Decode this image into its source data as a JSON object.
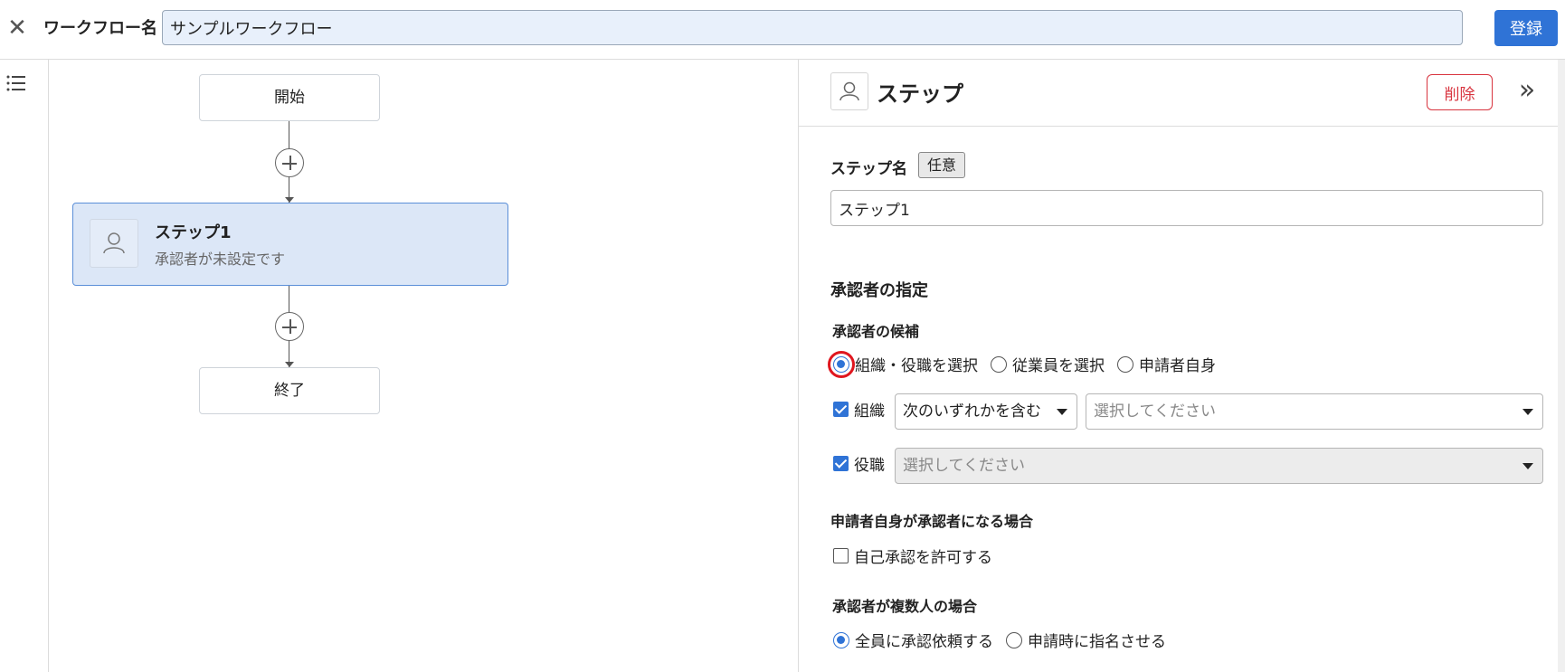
{
  "header": {
    "workflow_name_label": "ワークフロー名",
    "workflow_name_value": "サンプルワークフロー",
    "register_label": "登録"
  },
  "canvas": {
    "start_label": "開始",
    "end_label": "終了",
    "step": {
      "title": "ステップ1",
      "subtitle": "承認者が未設定です"
    }
  },
  "panel": {
    "title": "ステップ",
    "delete_label": "削除",
    "step_name_label": "ステップ名",
    "optional_badge": "任意",
    "step_name_value": "ステップ1",
    "approver_spec_heading": "承認者の指定",
    "candidates_label": "承認者の候補",
    "candidate_options": [
      {
        "label": "組織・役職を選択",
        "selected": true
      },
      {
        "label": "従業員を選択",
        "selected": false
      },
      {
        "label": "申請者自身",
        "selected": false
      }
    ],
    "org": {
      "label": "組織",
      "checked": true,
      "condition_value": "次のいずれかを含む",
      "select_placeholder": "選択してください"
    },
    "position": {
      "label": "役職",
      "checked": true,
      "select_placeholder": "選択してください"
    },
    "self_approver_heading": "申請者自身が承認者になる場合",
    "self_approve_option": {
      "label": "自己承認を許可する",
      "checked": false
    },
    "multiple_heading": "承認者が複数人の場合",
    "multiple_options": [
      {
        "label": "全員に承認依頼する",
        "selected": true
      },
      {
        "label": "申請時に指名させる",
        "selected": false
      }
    ]
  },
  "colors": {
    "accent": "#2f73d6",
    "danger": "#d8343f",
    "step_fill": "#dce7f7",
    "highlight": "#e0161e"
  }
}
